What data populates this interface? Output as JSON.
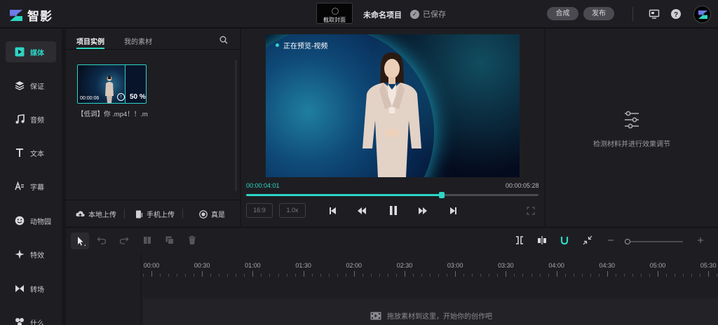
{
  "app": {
    "name": "智影",
    "brand_color": "#2dd5c4"
  },
  "header": {
    "cover_button": "截取封面",
    "project_title": "未命名项目",
    "save_status": "已保存",
    "compose_label": "合成",
    "publish_label": "发布"
  },
  "sidebar": {
    "items": [
      {
        "label": "媒体",
        "icon": "play-square-icon",
        "active": true
      },
      {
        "label": "保证",
        "icon": "layers-icon",
        "active": false
      },
      {
        "label": "音频",
        "icon": "music-note-icon",
        "active": false
      },
      {
        "label": "文本",
        "icon": "text-T-icon",
        "active": false
      },
      {
        "label": "字幕",
        "icon": "subtitle-icon",
        "active": false
      },
      {
        "label": "动物园",
        "icon": "smiley-icon",
        "active": false
      },
      {
        "label": "特效",
        "icon": "sparkle-icon",
        "active": false
      },
      {
        "label": "转场",
        "icon": "transition-icon",
        "active": false
      },
      {
        "label": "什么",
        "icon": "more-icon",
        "active": false
      }
    ]
  },
  "media": {
    "tabs": [
      "项目实例",
      "我的素材"
    ],
    "active_tab": 0,
    "item": {
      "name": "【低调】你 .mp4！！.m",
      "duration": "00:00:06",
      "upload_percent": "50 %"
    },
    "footer": {
      "local_upload": "本地上传",
      "phone_upload": "手机上传",
      "real": "真是"
    }
  },
  "preview": {
    "label": "正在预览-视频",
    "current_time": "00:00:04:01",
    "total_time": "00:00:05:28",
    "progress": 0.67,
    "ratio": "16:9",
    "speed": "1.0x"
  },
  "effects_panel": {
    "hint": "检测材料并进行效果调节"
  },
  "timeline": {
    "ticks": [
      "00:00",
      "00:30",
      "01:00",
      "01:30",
      "02:00",
      "02:30",
      "03:00",
      "03:30",
      "04:00",
      "04:30",
      "05:00",
      "05:30"
    ],
    "drop_hint": "拖放素材到这里，开始你的创作吧"
  }
}
